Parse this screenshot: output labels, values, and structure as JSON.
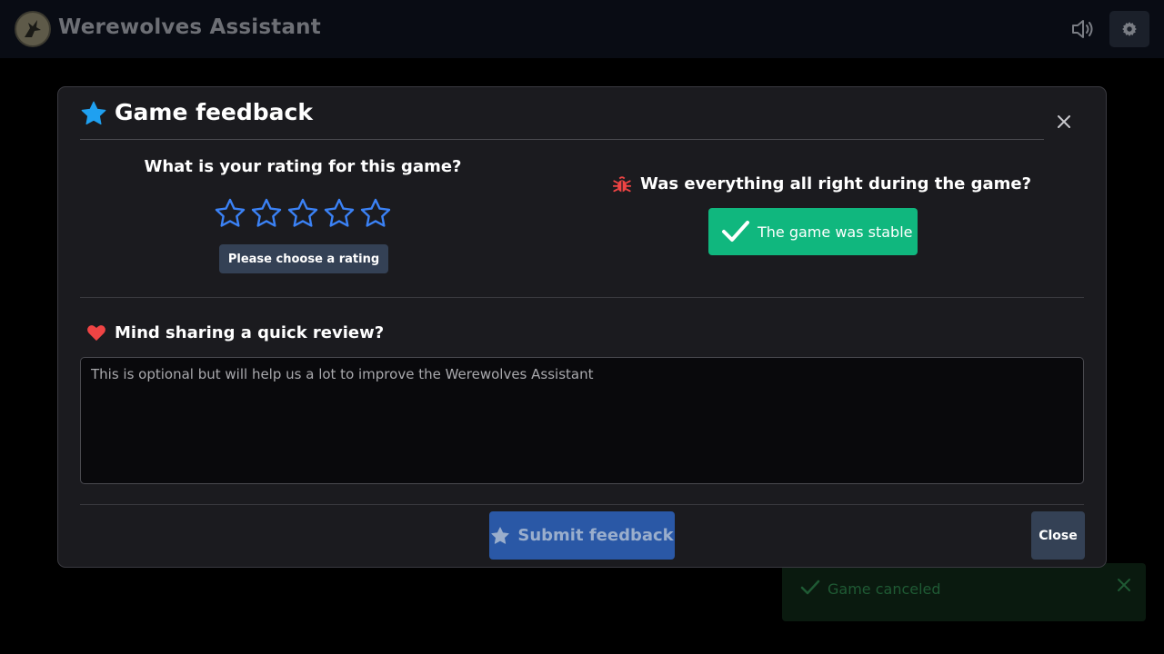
{
  "header": {
    "title": "Werewolves Assistant",
    "logo_icon": "wolf-logo-icon",
    "sound_icon": "speaker-volume-icon",
    "settings_icon": "gear-icon"
  },
  "modal": {
    "title": "Game feedback",
    "title_icon": "star-icon",
    "close_icon": "close-icon",
    "rating": {
      "question": "What is your rating for this game?",
      "stars": 5,
      "selected": 0,
      "badge": "Please choose a rating"
    },
    "stability": {
      "question": "Was everything all right during the game?",
      "icon": "bug-icon",
      "button_label": "The game was stable"
    },
    "review": {
      "question": "Mind sharing a quick review?",
      "icon": "heart-icon",
      "value": "",
      "placeholder": "This is optional but will help us a lot to improve the Werewolves Assistant"
    },
    "footer": {
      "submit_label": "Submit feedback",
      "close_label": "Close"
    }
  },
  "toast": {
    "text": "Game canceled",
    "icon": "check-icon"
  },
  "colors": {
    "accent_star": "#1fa0f0",
    "rating_star_outline": "#3b82f6",
    "success": "#10b77e",
    "danger": "#ef4444",
    "submit": "#2a58a6",
    "secondary": "#344155"
  }
}
